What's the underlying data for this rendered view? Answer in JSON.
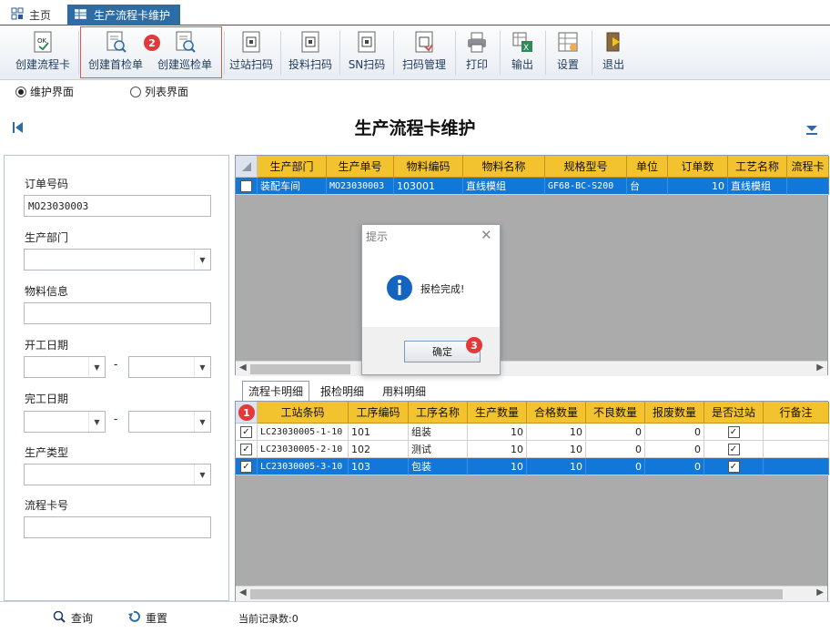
{
  "tabs": {
    "home": "主页",
    "flow": "生产流程卡维护"
  },
  "toolbar": [
    {
      "label": "创建流程卡",
      "icon": "ok-doc-icon"
    },
    {
      "label": "创建首检单",
      "icon": "inspect-doc-icon"
    },
    {
      "label": "创建巡检单",
      "icon": "inspect-doc-icon"
    },
    {
      "label": "过站扫码",
      "icon": "scan-icon"
    },
    {
      "label": "投料扫码",
      "icon": "scan-icon"
    },
    {
      "label": "SN扫码",
      "icon": "scan-icon"
    },
    {
      "label": "扫码管理",
      "icon": "scan-manage-icon"
    },
    {
      "label": "打印",
      "icon": "printer-icon"
    },
    {
      "label": "输出",
      "icon": "export-icon"
    },
    {
      "label": "设置",
      "icon": "settings-icon"
    },
    {
      "label": "退出",
      "icon": "exit-icon"
    }
  ],
  "radios": {
    "maintain": "维护界面",
    "list": "列表界面"
  },
  "title": "生产流程卡维护",
  "form": {
    "order_no_label": "订单号码",
    "order_no_value": "MO23030003",
    "dept_label": "生产部门",
    "material_label": "物料信息",
    "start_label": "开工日期",
    "end_label": "完工日期",
    "type_label": "生产类型",
    "card_label": "流程卡号",
    "dash": "-"
  },
  "grid1": {
    "headers": [
      "生产部门",
      "生产单号",
      "物料编码",
      "物料名称",
      "规格型号",
      "单位",
      "订单数",
      "工艺名称",
      "流程卡"
    ],
    "rows": [
      [
        "装配车间",
        "MO23030003",
        "103001",
        "直线模组",
        "GF68-BC-S200",
        "台",
        "10",
        "直线模组",
        ""
      ]
    ]
  },
  "subtabs": [
    "流程卡明细",
    "报检明细",
    "用料明细"
  ],
  "grid2": {
    "headers": [
      "工站条码",
      "工序编码",
      "工序名称",
      "生产数量",
      "合格数量",
      "不良数量",
      "报废数量",
      "是否过站",
      "行备注"
    ],
    "rows": [
      [
        "LC23030005-1-10",
        "101",
        "组装",
        "10",
        "10",
        "0",
        "0"
      ],
      [
        "LC23030005-2-10",
        "102",
        "测试",
        "10",
        "10",
        "0",
        "0"
      ],
      [
        "LC23030005-3-10",
        "103",
        "包装",
        "10",
        "10",
        "0",
        "0"
      ]
    ]
  },
  "dialog": {
    "title": "提示",
    "message": "报检完成!",
    "ok": "确定"
  },
  "footer": {
    "query": "查询",
    "reset": "重置",
    "record_count": "当前记录数:0"
  },
  "badges": [
    "1",
    "2",
    "3"
  ],
  "colors": {
    "header": "#f3c22f",
    "selected": "#1177d9",
    "accent": "#2e6da4"
  }
}
